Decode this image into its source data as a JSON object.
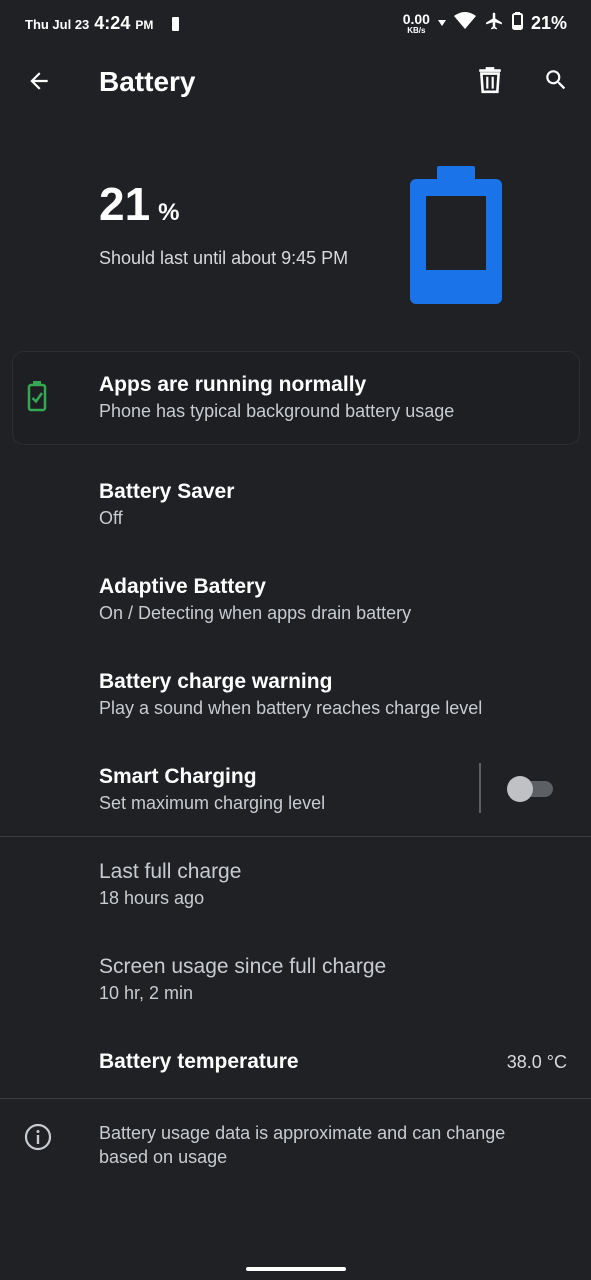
{
  "status_bar": {
    "date": "Thu Jul 23",
    "time": "4:24",
    "ampm": "PM",
    "net_speed": "0.00",
    "net_unit": "KB/s",
    "battery_pct": "21%"
  },
  "toolbar": {
    "title": "Battery",
    "back_icon": "arrow-back-icon",
    "delete_icon": "trash-icon",
    "search_icon": "search-icon"
  },
  "header": {
    "percent": "21",
    "percent_symbol": "%",
    "estimate": "Should last until about 9:45 PM",
    "battery_color": "#1a73e8",
    "level": 0.21
  },
  "tip_card": {
    "title": "Apps are running normally",
    "subtitle": "Phone has typical background battery usage",
    "icon_color": "#34a853"
  },
  "settings": [
    {
      "title": "Battery Saver",
      "subtitle": "Off"
    },
    {
      "title": "Adaptive Battery",
      "subtitle": "On / Detecting when apps drain battery"
    },
    {
      "title": "Battery charge warning",
      "subtitle": "Play a sound when battery reaches charge level"
    },
    {
      "title": "Smart Charging",
      "subtitle": "Set maximum charging level",
      "toggle": false
    }
  ],
  "stats": {
    "last_full_charge": {
      "title": "Last full charge",
      "value": "18 hours ago"
    },
    "screen_usage": {
      "title": "Screen usage since full charge",
      "value": "10 hr, 2 min"
    },
    "temperature": {
      "title": "Battery temperature",
      "value": "38.0 °C"
    }
  },
  "footer": {
    "text": "Battery usage data is approximate and can change based on usage",
    "icon": "info-icon"
  }
}
